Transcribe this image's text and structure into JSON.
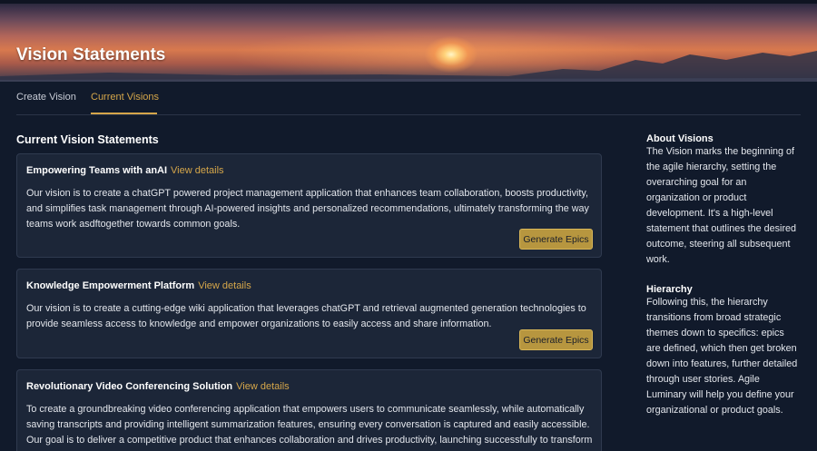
{
  "header": {
    "title": "Vision Statements"
  },
  "tabs": [
    {
      "label": "Create Vision",
      "active": false
    },
    {
      "label": "Current Visions",
      "active": true
    }
  ],
  "main": {
    "section_title": "Current Vision Statements",
    "visions": [
      {
        "title": "Empowering Teams with anAI",
        "link_label": "View details",
        "description": "Our vision is to create a chatGPT powered project management application that enhances team collaboration, boosts productivity, and simplifies task management through AI-powered insights and personalized recommendations, ultimately transforming the way teams work asdftogether towards common goals.",
        "button_label": "Generate Epics"
      },
      {
        "title": "Knowledge Empowerment Platform",
        "link_label": "View details",
        "description": "Our vision is to create a cutting-edge wiki application that leverages chatGPT and retrieval augmented generation technologies to provide seamless access to knowledge and empower organizations to easily access and share information.",
        "button_label": "Generate Epics"
      },
      {
        "title": "Revolutionary Video Conferencing Solution",
        "link_label": "View details",
        "description": "To create a groundbreaking video conferencing application that empowers users to communicate seamlessly, while automatically saving transcripts and providing intelligent summarization features, ensuring every conversation is captured and easily accessible. Our goal is to deliver a competitive product that enhances collaboration and drives productivity, launching successfully to transform the way teams connect and share ideas."
      }
    ]
  },
  "sidebar": {
    "about_heading": "About Visions",
    "about_text": "The Vision marks the beginning of the agile hierarchy, setting the overarching goal for an organization or product development. It's a high-level statement that outlines the desired outcome, steering all subsequent work.",
    "hierarchy_heading": "Hierarchy",
    "hierarchy_text": "Following this, the hierarchy transitions from broad strategic themes down to specifics: epics are defined, which then get broken down into features, further detailed through user stories. Agile Luminary will help you define your organizational or product goals."
  },
  "colors": {
    "accent": "#d5a64a",
    "background": "#111a2b",
    "card": "#1c2638",
    "button": "#b7963f"
  }
}
